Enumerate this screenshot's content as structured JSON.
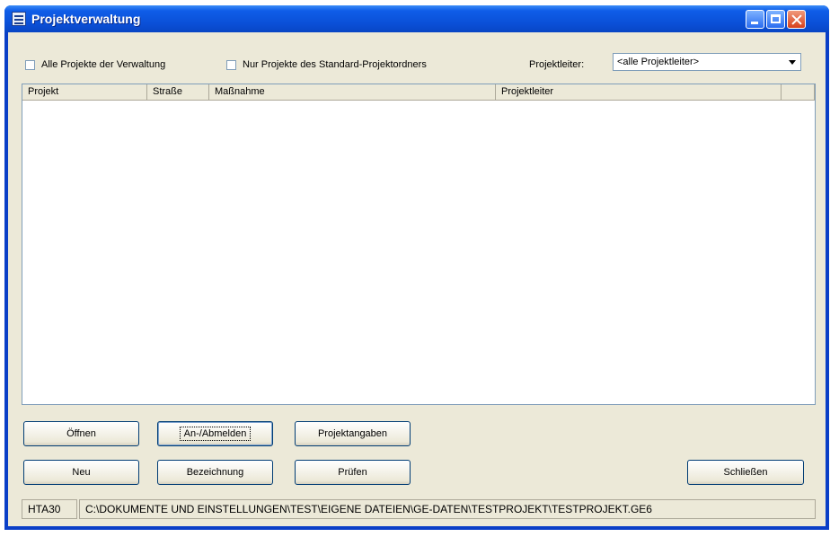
{
  "window": {
    "title": "Projektverwaltung"
  },
  "filters": {
    "all_projects_label": "Alle Projekte der Verwaltung",
    "standard_folder_label": "Nur Projekte des Standard-Projektordners",
    "leader_label": "Projektleiter:",
    "leader_value": "<alle Projektleiter>"
  },
  "table": {
    "columns": [
      "Projekt",
      "Straße",
      "Maßnahme",
      "Projektleiter"
    ],
    "rows": []
  },
  "buttons": {
    "open": "Öffnen",
    "login": "An-/Abmelden",
    "details": "Projektangaben",
    "new": "Neu",
    "rename": "Bezeichnung",
    "check": "Prüfen",
    "close": "Schließen"
  },
  "status": {
    "code": "HTA30",
    "path": "C:\\DOKUMENTE UND EINSTELLUNGEN\\TEST\\EIGENE DATEIEN\\GE-DATEN\\TESTPROJEKT\\TESTPROJEKT.GE6"
  }
}
